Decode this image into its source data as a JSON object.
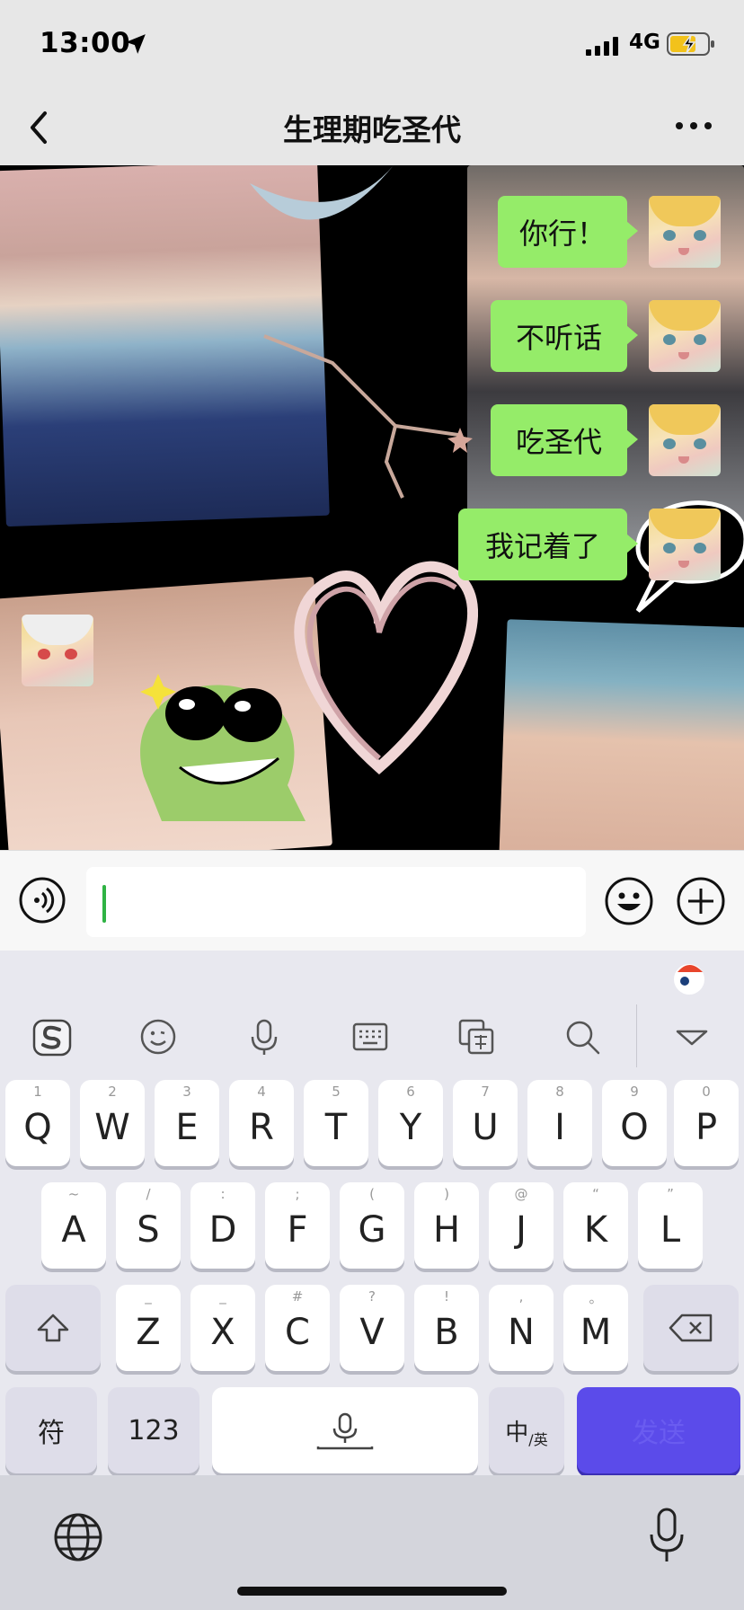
{
  "status_bar": {
    "time": "13:00",
    "network": "4G"
  },
  "nav": {
    "title": "生理期吃圣代"
  },
  "messages": [
    {
      "text": "你行！"
    },
    {
      "text": "不听话"
    },
    {
      "text": "吃圣代"
    },
    {
      "text": "我记着了"
    }
  ],
  "input": {
    "value": "",
    "placeholder": ""
  },
  "keyboard": {
    "row1": [
      {
        "main": "Q",
        "sub": "1"
      },
      {
        "main": "W",
        "sub": "2"
      },
      {
        "main": "E",
        "sub": "3"
      },
      {
        "main": "R",
        "sub": "4"
      },
      {
        "main": "T",
        "sub": "5"
      },
      {
        "main": "Y",
        "sub": "6"
      },
      {
        "main": "U",
        "sub": "7"
      },
      {
        "main": "I",
        "sub": "8"
      },
      {
        "main": "O",
        "sub": "9"
      },
      {
        "main": "P",
        "sub": "0"
      }
    ],
    "row2": [
      {
        "main": "A",
        "sub": "~"
      },
      {
        "main": "S",
        "sub": "/"
      },
      {
        "main": "D",
        "sub": ":"
      },
      {
        "main": "F",
        "sub": ";"
      },
      {
        "main": "G",
        "sub": "("
      },
      {
        "main": "H",
        "sub": ")"
      },
      {
        "main": "J",
        "sub": "@"
      },
      {
        "main": "K",
        "sub": "“"
      },
      {
        "main": "L",
        "sub": "”"
      }
    ],
    "row3": [
      {
        "main": "Z",
        "sub": "_"
      },
      {
        "main": "X",
        "sub": "_"
      },
      {
        "main": "C",
        "sub": "#"
      },
      {
        "main": "V",
        "sub": "?"
      },
      {
        "main": "B",
        "sub": "!"
      },
      {
        "main": "N",
        "sub": ","
      },
      {
        "main": "M",
        "sub": "。"
      }
    ],
    "fu_label": "符",
    "num_label": "123",
    "lang_main": "中",
    "lang_sub": "/英",
    "send_label": "发送"
  },
  "colors": {
    "bubble": "#95ec69",
    "chat_bg": "#000000",
    "send_key": "#5b4bea",
    "caret": "#2fb344"
  },
  "icons": {
    "toolbar": [
      "sogou-logo-icon",
      "emoji-icon",
      "microphone-icon",
      "keyboard-icon",
      "translate-icon",
      "search-icon",
      "collapse-icon"
    ]
  }
}
